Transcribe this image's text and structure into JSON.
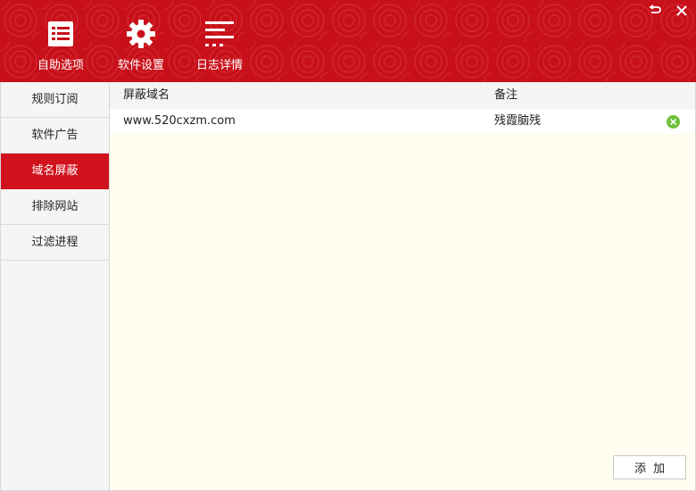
{
  "toolbar": {
    "options_label": "自助选项",
    "settings_label": "软件设置",
    "logs_label": "日志详情"
  },
  "window_controls": {
    "restore_icon": "return-arrow-icon",
    "close_icon": "close-icon"
  },
  "sidebar": {
    "items": [
      {
        "label": "规则订阅",
        "active": false
      },
      {
        "label": "软件广告",
        "active": false
      },
      {
        "label": "域名屏蔽",
        "active": true
      },
      {
        "label": "排除网站",
        "active": false
      },
      {
        "label": "过滤进程",
        "active": false
      }
    ]
  },
  "table": {
    "columns": [
      "屏蔽域名",
      "备注"
    ],
    "rows": [
      {
        "domain": "www.520cxzm.com",
        "note": "残霞脑残"
      }
    ]
  },
  "actions": {
    "add_label": "添加"
  },
  "colors": {
    "brand_red": "#c8101a",
    "active_red": "#d0121c",
    "delete_green": "#6fbf3a",
    "content_bg": "#fffdf0"
  }
}
